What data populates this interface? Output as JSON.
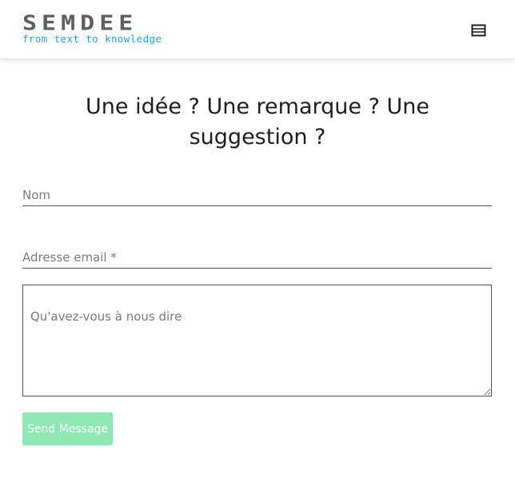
{
  "header": {
    "logo_text": "SEMDEE",
    "logo_tagline": "from text to knowledge",
    "menu_icon": "hamburger-menu-icon"
  },
  "main": {
    "title": "Une idée ? Une remarque ? Une suggestion ?"
  },
  "form": {
    "name_placeholder": "Nom",
    "email_placeholder": "Adresse email *",
    "message_placeholder": "Qu'avez-vous à nous dire",
    "submit_label": "Send Message"
  },
  "colors": {
    "logo": "#5f5f5f",
    "tagline": "#2b9fd6",
    "button": "#8fe8b4",
    "button_text": "#ffffff"
  }
}
